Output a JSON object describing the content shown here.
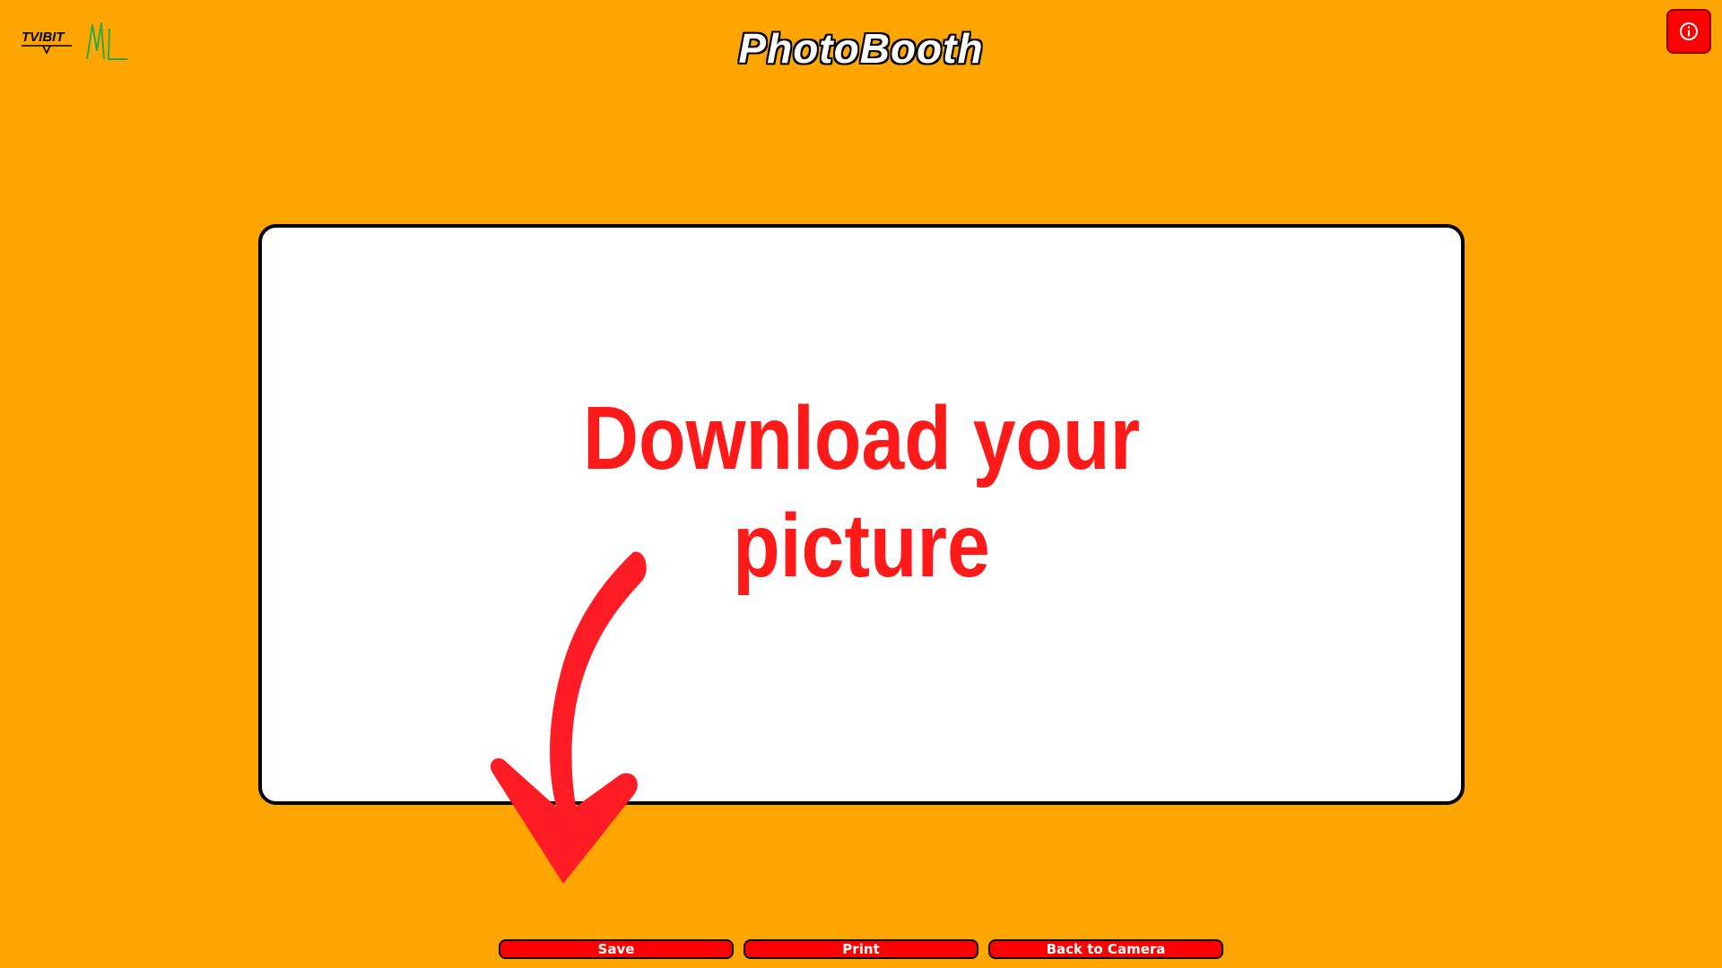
{
  "colors": {
    "background": "#ffa500",
    "accent": "#ff0000",
    "placeholder_text": "#ff1a1a",
    "arrow": "#ff1c24"
  },
  "header": {
    "title": "PhotoBooth",
    "logos": [
      {
        "icon": "tvibit-logo",
        "text": "TVIBIT"
      },
      {
        "icon": "ml-logo",
        "text": "ML"
      }
    ],
    "info_button": {
      "icon": "info-icon"
    }
  },
  "preview": {
    "line1": "Download your",
    "line2": "picture",
    "arrow_icon": "arrow-down-icon"
  },
  "actions": {
    "save_label": "Save",
    "print_label": "Print",
    "back_label": "Back to Camera"
  }
}
